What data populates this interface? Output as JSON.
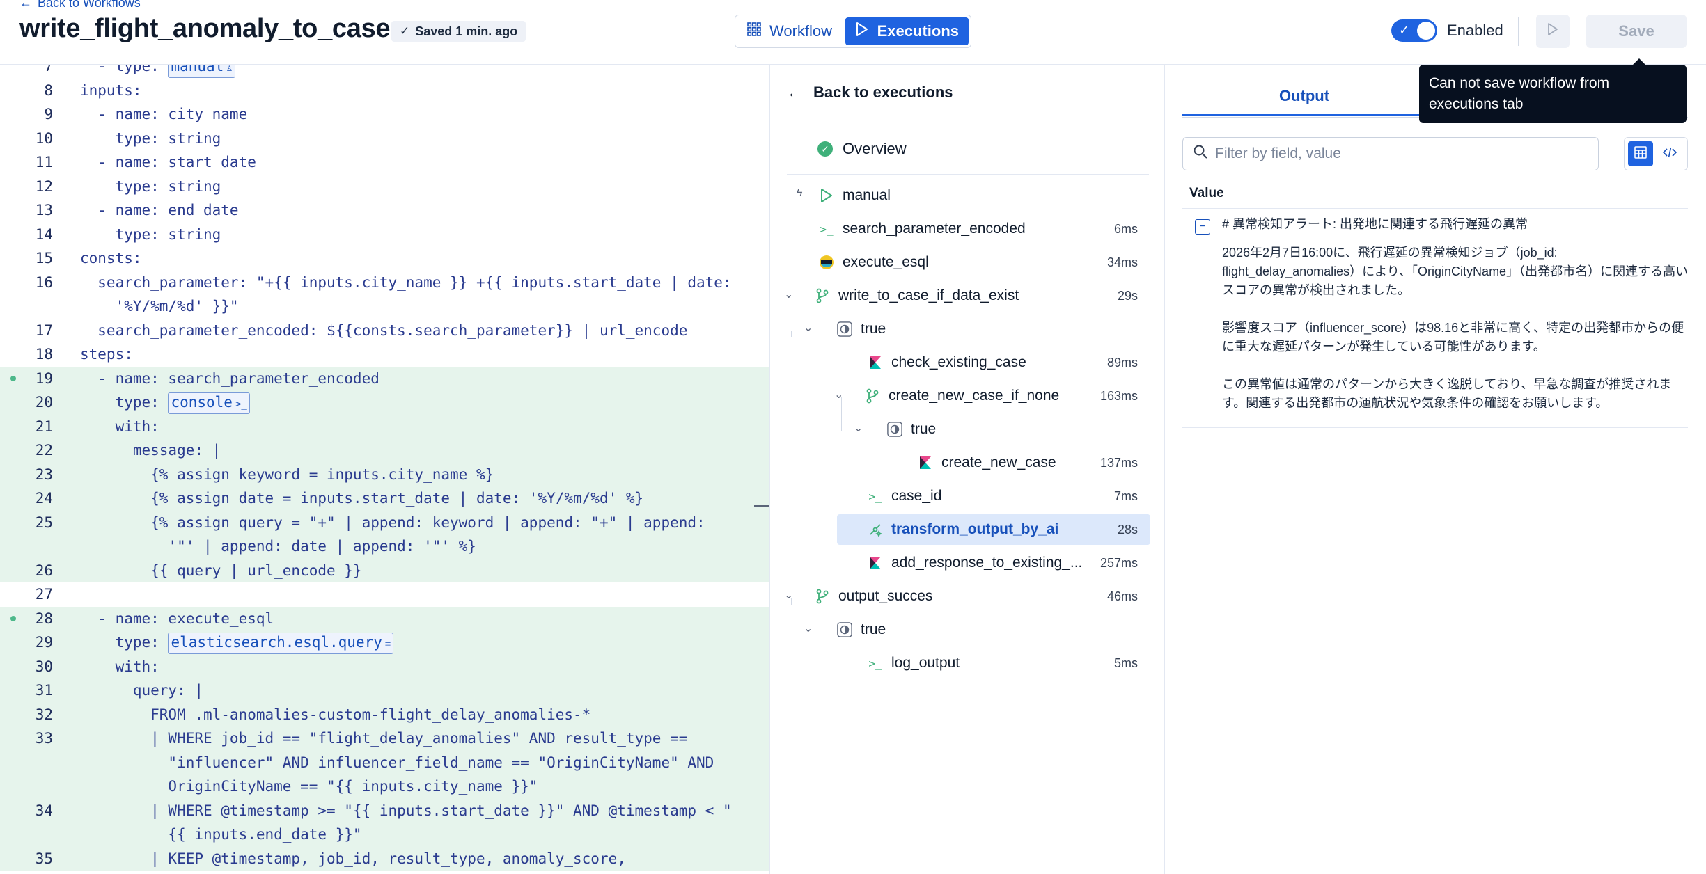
{
  "header": {
    "back_label": "Back to Workflows",
    "title": "write_flight_anomaly_to_case",
    "saved_label": "Saved 1 min. ago",
    "tab_workflow": "Workflow",
    "tab_executions": "Executions",
    "enabled_label": "Enabled",
    "save_label": "Save",
    "tooltip": "Can not save workflow from executions tab"
  },
  "code": {
    "lines": [
      {
        "n": "7",
        "text": "  - type: "
      },
      {
        "n": "8",
        "text": "inputs:"
      },
      {
        "n": "9",
        "text": "  - name: city_name"
      },
      {
        "n": "10",
        "text": "    type: string"
      },
      {
        "n": "11",
        "text": "  - name: start_date"
      },
      {
        "n": "12",
        "text": "    type: string"
      },
      {
        "n": "13",
        "text": "  - name: end_date"
      },
      {
        "n": "14",
        "text": "    type: string"
      },
      {
        "n": "15",
        "text": "consts:"
      },
      {
        "n": "16",
        "text": "  search_parameter: \"+{{ inputs.city_name }} +{{ inputs.start_date | date:"
      },
      {
        "n": "",
        "text": "    '%Y/%m/%d' }}\""
      },
      {
        "n": "17",
        "text": "  search_parameter_encoded: ${{consts.search_parameter}} | url_encode"
      },
      {
        "n": "18",
        "text": "steps:"
      },
      {
        "n": "19",
        "text": "  - name: search_parameter_encoded"
      },
      {
        "n": "20",
        "text": "    type: "
      },
      {
        "n": "21",
        "text": "    with:"
      },
      {
        "n": "22",
        "text": "      message: |"
      },
      {
        "n": "23",
        "text": "        {% assign keyword = inputs.city_name %}"
      },
      {
        "n": "24",
        "text": "        {% assign date = inputs.start_date | date: '%Y/%m/%d' %}"
      },
      {
        "n": "25",
        "text": "        {% assign query = \"+\" | append: keyword | append: \"+\" | append:"
      },
      {
        "n": "",
        "text": "          '\"' | append: date | append: '\"' %}"
      },
      {
        "n": "26",
        "text": "        {{ query | url_encode }}"
      },
      {
        "n": "27",
        "text": ""
      },
      {
        "n": "28",
        "text": "  - name: execute_esql"
      },
      {
        "n": "29",
        "text": "    type: "
      },
      {
        "n": "30",
        "text": "    with:"
      },
      {
        "n": "31",
        "text": "      query: |"
      },
      {
        "n": "32",
        "text": "        FROM .ml-anomalies-custom-flight_delay_anomalies-*"
      },
      {
        "n": "33",
        "text": "        | WHERE job_id == \"flight_delay_anomalies\" AND result_type =="
      },
      {
        "n": "",
        "text": "          \"influencer\" AND influencer_field_name == \"OriginCityName\" AND"
      },
      {
        "n": "",
        "text": "          OriginCityName == \"{{ inputs.city_name }}\""
      },
      {
        "n": "34",
        "text": "        | WHERE @timestamp >= \"{{ inputs.start_date }}\" AND @timestamp < \""
      },
      {
        "n": "",
        "text": "          {{ inputs.end_date }}\""
      },
      {
        "n": "35",
        "text": "        | KEEP @timestamp, job_id, result_type, anomaly_score,"
      }
    ],
    "chip_manual": "manual",
    "chip_console": "console",
    "chip_esql": "elasticsearch.esql.query"
  },
  "executions": {
    "back_label": "Back to executions",
    "overview_label": "Overview",
    "nodes": [
      {
        "label": "manual",
        "duration": ""
      },
      {
        "label": "search_parameter_encoded",
        "duration": "6ms"
      },
      {
        "label": "execute_esql",
        "duration": "34ms"
      },
      {
        "label": "write_to_case_if_data_exist",
        "duration": "29s"
      },
      {
        "label": "true",
        "duration": ""
      },
      {
        "label": "check_existing_case",
        "duration": "89ms"
      },
      {
        "label": "create_new_case_if_none",
        "duration": "163ms"
      },
      {
        "label": "true",
        "duration": ""
      },
      {
        "label": "create_new_case",
        "duration": "137ms"
      },
      {
        "label": "case_id",
        "duration": "7ms"
      },
      {
        "label": "transform_output_by_ai",
        "duration": "28s"
      },
      {
        "label": "add_response_to_existing_...",
        "duration": "257ms"
      },
      {
        "label": "output_succes",
        "duration": "46ms"
      },
      {
        "label": "true",
        "duration": ""
      },
      {
        "label": "log_output",
        "duration": "5ms"
      }
    ]
  },
  "output": {
    "tab_label": "Output",
    "filter_placeholder": "Filter by field, value",
    "value_header": "Value",
    "value_heading": "# 異常検知アラート: 出発地に関連する飛行遅延の異常",
    "value_p1": "2026年2月7日16:00に、飛行遅延の異常検知ジョブ（job_id: flight_delay_anomalies）により、「OriginCityName」（出発都市名）に関連する高いスコアの異常が検出されました。",
    "value_p2": "影響度スコア（influencer_score）は98.16と非常に高く、特定の出発都市からの便に重大な遅延パターンが発生している可能性があります。",
    "value_p3": "この異常値は通常のパターンから大きく逸脱しており、早急な調査が推奨されます。関連する出発都市の運航状況や気象条件の確認をお願いします。"
  }
}
